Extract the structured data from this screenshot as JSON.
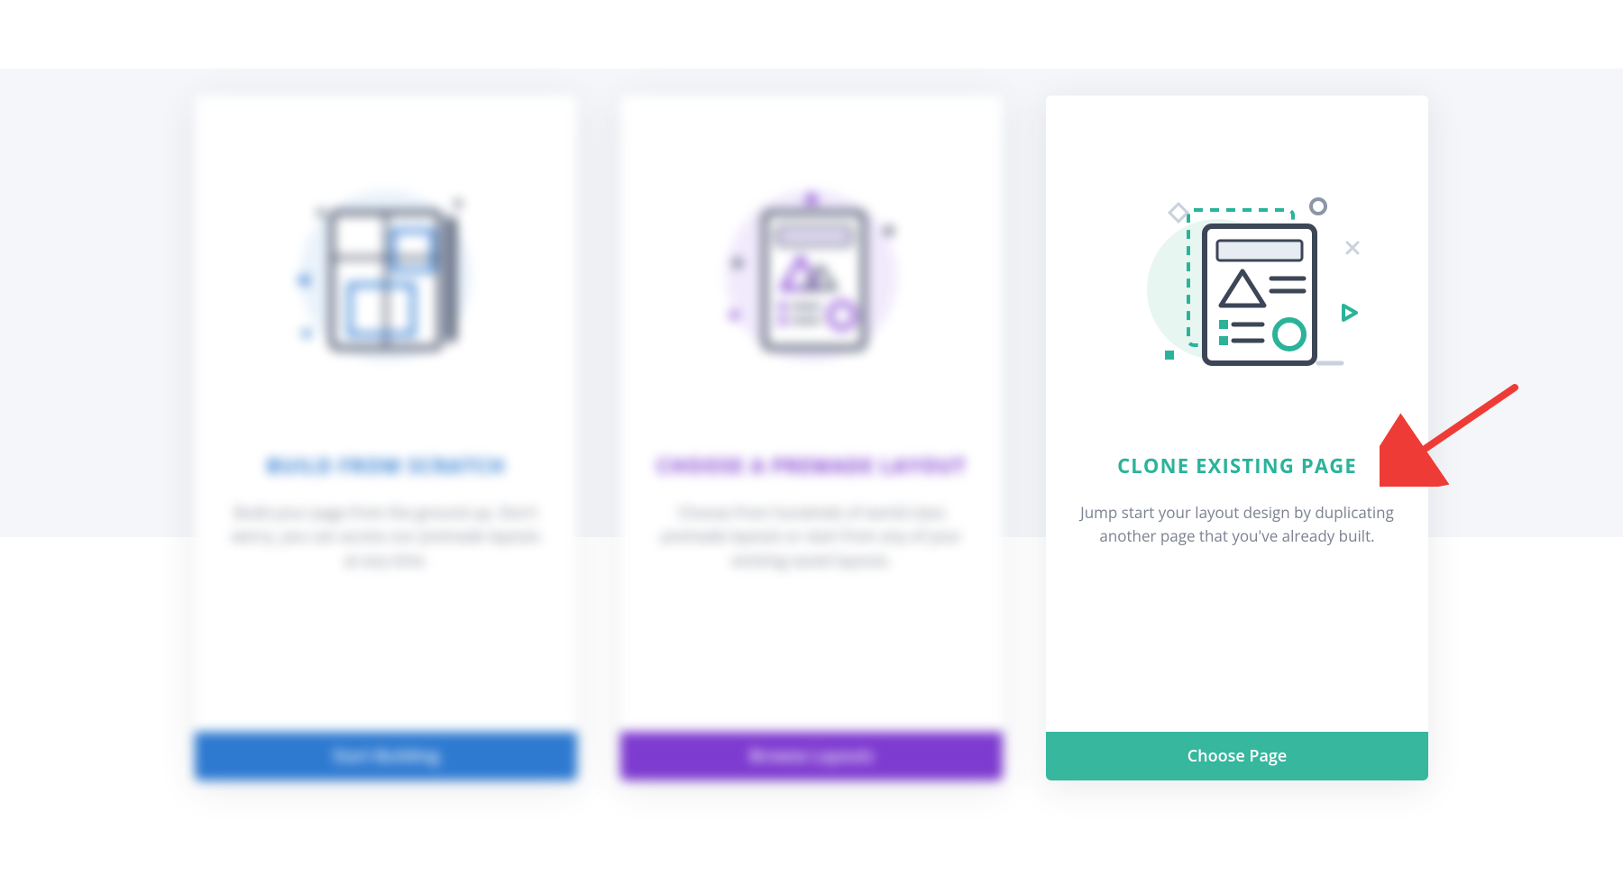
{
  "cards": [
    {
      "title": "BUILD FROM SCRATCH",
      "desc": "Build your page from the ground up. Don't worry, you can access our premade layouts at any time.",
      "button": "Start Building"
    },
    {
      "title": "CHOOSE A PREMADE LAYOUT",
      "desc": "Choose from hundreds of world-class premade layouts or start from any of your existing saved layouts.",
      "button": "Browse Layouts"
    },
    {
      "title": "CLONE EXISTING PAGE",
      "desc": "Jump start your layout design by duplicating another page that you've already built.",
      "button": "Choose Page"
    }
  ],
  "colors": {
    "blue": "#2e7ad1",
    "purple": "#7e3bd0",
    "teal": "#2bb39a",
    "arrow": "#ef3b36"
  }
}
